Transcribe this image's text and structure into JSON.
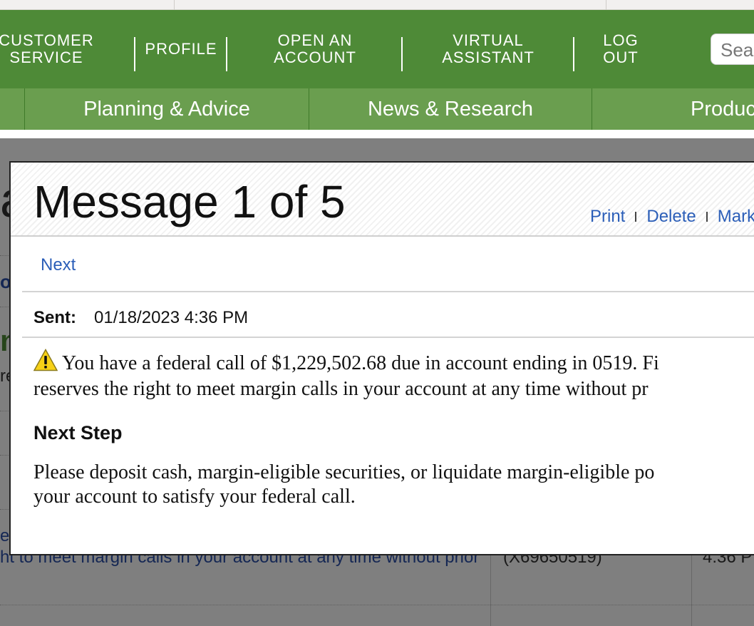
{
  "utility_nav": {
    "items": [
      {
        "label": "CUSTOMER\nSERVICE"
      },
      {
        "label": "PROFILE"
      },
      {
        "label": "OPEN AN\nACCOUNT"
      },
      {
        "label": "VIRTUAL\nASSISTANT"
      },
      {
        "label": "LOG\nOUT"
      }
    ],
    "search_placeholder": "Sear"
  },
  "main_nav": {
    "items": [
      {
        "label": "Planning & Advice"
      },
      {
        "label": "News & Research"
      },
      {
        "label": "Produc"
      }
    ]
  },
  "background": {
    "partial_link_1": "er",
    "partial_link_2": "ht to meet margin calls in your account at any time without prior",
    "partial_cell_account": "(X69650519)",
    "partial_cell_time": "4:36 P",
    "glyph_a": "a",
    "glyph_o": "o",
    "glyph_n": "n",
    "glyph_re": "re"
  },
  "modal": {
    "title": "Message 1 of 5",
    "actions": {
      "print": "Print",
      "delete": "Delete",
      "mark": "Mark"
    },
    "next_label": "Next",
    "sent_label": "Sent:",
    "sent_value": "01/18/2023 4:36 PM",
    "alert_icon": "warning-icon",
    "body_line_1": "You have a federal call of $1,229,502.68 due in account ending in 0519. Fi",
    "body_line_2": "reserves the right to meet margin calls in your account at any time without pr",
    "next_step_heading": "Next Step",
    "next_step_line_1": "Please deposit cash, margin-eligible securities, or liquidate margin-eligible po",
    "next_step_line_2": "your account to satisfy your federal call."
  },
  "colors": {
    "utility_green": "#4e8a37",
    "main_nav_green": "#6a9e4f",
    "link_blue": "#2b5eb8"
  }
}
